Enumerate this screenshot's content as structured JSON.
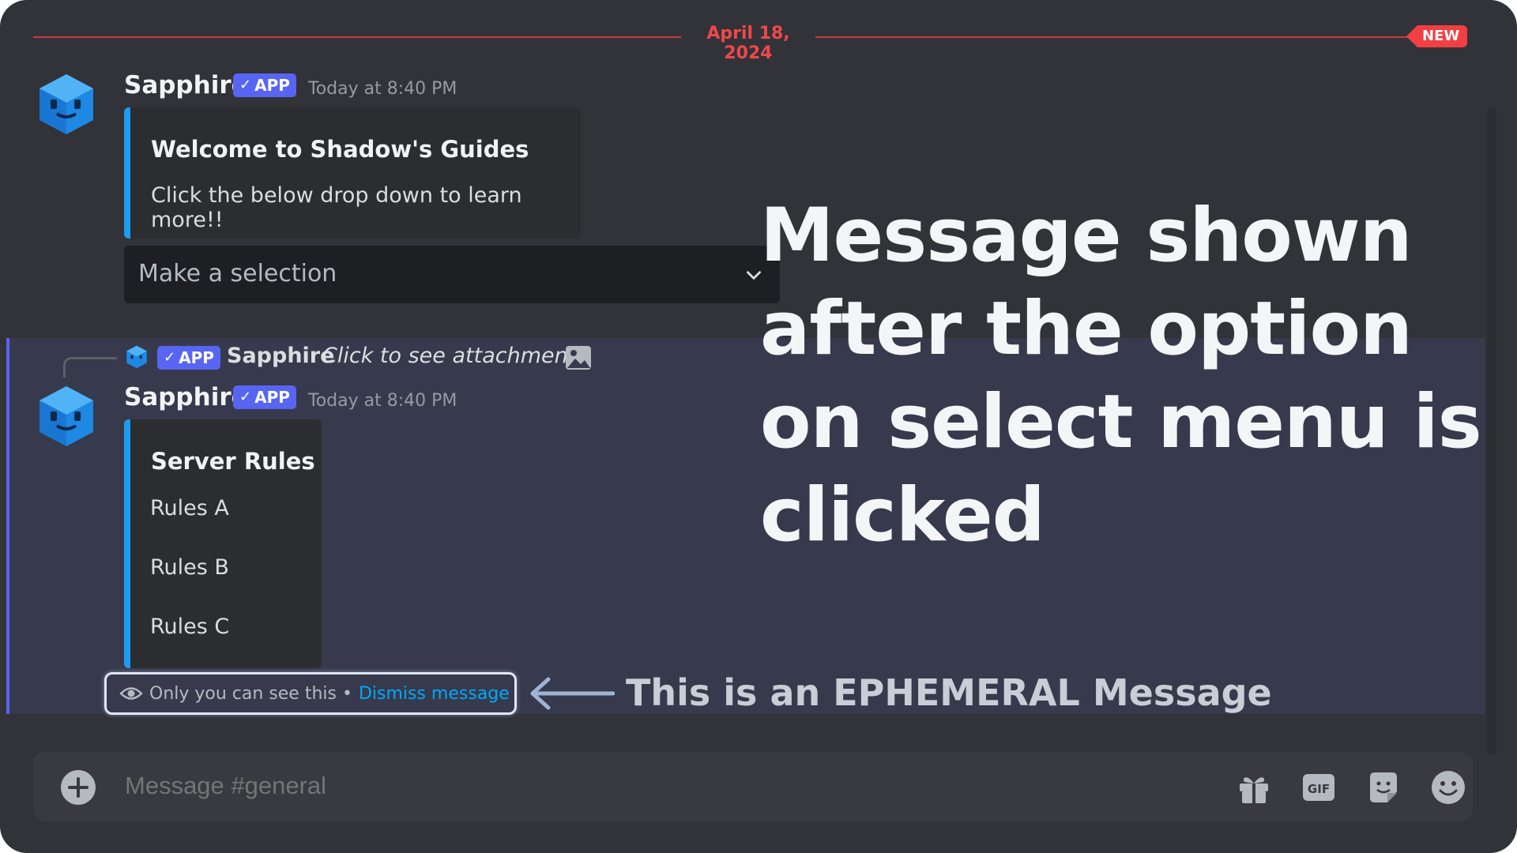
{
  "divider": {
    "date": "April 18, 2024",
    "new_badge": "NEW"
  },
  "message1": {
    "username": "Sapphire",
    "app_badge": "APP",
    "timestamp": "Today at 8:40 PM",
    "embed_title": "Welcome to Shadow's Guides",
    "embed_text": "Click the below drop down to learn more!!",
    "select_placeholder": "Make a selection"
  },
  "reply": {
    "app_badge": "APP",
    "username": "Sapphire",
    "text": "Click to see attachment"
  },
  "message2": {
    "username": "Sapphire",
    "app_badge": "APP",
    "timestamp": "Today at 8:40 PM",
    "embed_title": "Server Rules",
    "items": [
      "Rules A",
      "Rules B",
      "Rules C"
    ],
    "notice_text": "Only you can see this •",
    "dismiss_link": "Dismiss message"
  },
  "annotations": {
    "big": "Message shown after the option on select menu is clicked",
    "small": "This is an EPHEMERAL Message"
  },
  "composer": {
    "placeholder": "Message #general"
  },
  "icons": {
    "avatar": "sapphire-avatar-icon",
    "plus": "add-plus-icon",
    "gift": "gift-icon",
    "gif": "gif-icon",
    "sticker": "sticker-icon",
    "emoji": "emoji-icon",
    "eye": "eye-icon",
    "image": "image-icon",
    "chevron": "chevron-down-icon"
  },
  "colors": {
    "background": "#313338",
    "accent": "#5865f2",
    "embed_border": "#1e9cf0",
    "date_divider": "#f0474a",
    "link": "#00a8fc"
  }
}
